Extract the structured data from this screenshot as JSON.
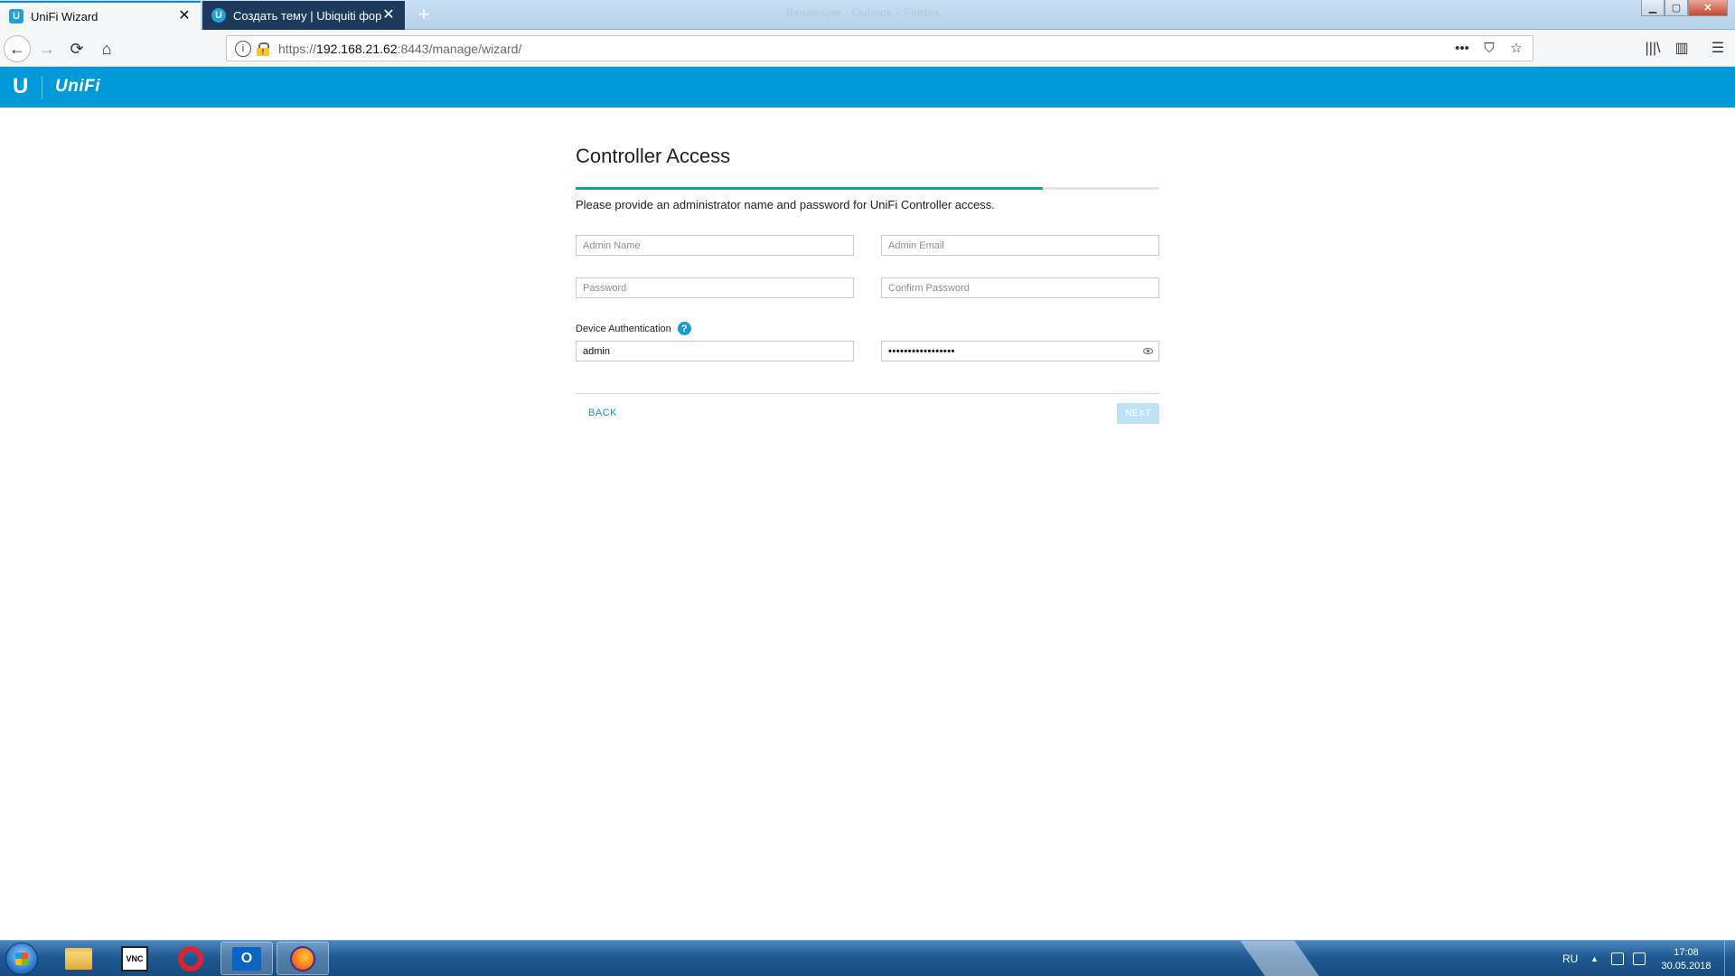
{
  "browser": {
    "window_title": "Входящие - Outlook - Firefox",
    "tabs": [
      {
        "label": "UniFi Wizard",
        "favicon": "U"
      },
      {
        "label": "Создать тему | Ubiquiti форум",
        "favicon": "U"
      }
    ],
    "close_glyph": "✕",
    "new_tab_glyph": "+",
    "url_prefix": "https://",
    "url_host": "192.168.21.62",
    "url_rest": ":8443/manage/wizard/",
    "info_glyph": "i",
    "nav": {
      "back": "←",
      "forward": "→",
      "reload": "⟳",
      "home": "⌂"
    },
    "url_actions": {
      "more": "•••",
      "pocket": "⛉",
      "bookmark": "☆"
    },
    "toolbar_right": {
      "library": "|||\\",
      "sidebar": "▥",
      "menu": "☰"
    },
    "window_controls": {
      "minimize": "▁",
      "maximize": "▢",
      "close": "✕"
    }
  },
  "app": {
    "logo_letter": "U",
    "brand": "UniFi"
  },
  "wizard": {
    "title": "Controller Access",
    "progress": 0.8,
    "subtitle": "Please provide an administrator name and password for UniFi Controller access.",
    "fields": {
      "admin_name": {
        "placeholder": "Admin Name",
        "value": ""
      },
      "admin_email": {
        "placeholder": "Admin Email",
        "value": ""
      },
      "password": {
        "placeholder": "Password",
        "value": ""
      },
      "confirm_password": {
        "placeholder": "Confirm Password",
        "value": ""
      }
    },
    "device_auth": {
      "label": "Device Authentication",
      "help_glyph": "?",
      "username": "admin",
      "password_masked": "•••••••••••••••••"
    },
    "back_label": "BACK",
    "next_label": "NEXT"
  },
  "taskbar": {
    "apps": [
      {
        "name": "explorer"
      },
      {
        "name": "vnc",
        "label": "VNC"
      },
      {
        "name": "opera"
      },
      {
        "name": "outlook",
        "label": "O"
      },
      {
        "name": "firefox"
      }
    ],
    "language": "RU",
    "tray_arrow": "▲",
    "time": "17:08",
    "date": "30.05.2018"
  }
}
